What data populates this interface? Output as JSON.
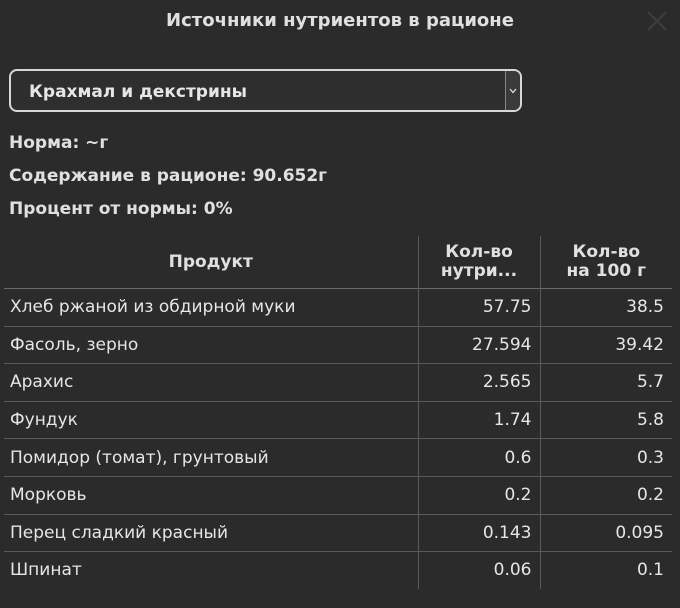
{
  "dialog": {
    "title": "Источники нутриентов в рационе"
  },
  "selector": {
    "selected": "Крахмал и декстрины"
  },
  "info": {
    "norm": "Норма: ~г",
    "content": "Содержание в рационе: 90.652г",
    "percent": "Процент от нормы: 0%"
  },
  "table": {
    "headers": {
      "product": "Продукт",
      "amount_line1": "Кол-во",
      "amount_line2": "нутри...",
      "per100_line1": "Кол-во",
      "per100_line2": "на 100 г"
    },
    "rows": [
      {
        "product": "Хлеб ржаной из обдирной муки",
        "amount": "57.75",
        "per100": "38.5"
      },
      {
        "product": "Фасоль, зерно",
        "amount": "27.594",
        "per100": "39.42"
      },
      {
        "product": "Арахис",
        "amount": "2.565",
        "per100": "5.7"
      },
      {
        "product": "Фундук",
        "amount": "1.74",
        "per100": "5.8"
      },
      {
        "product": "Помидор (томат), грунтовый",
        "amount": "0.6",
        "per100": "0.3"
      },
      {
        "product": "Морковь",
        "amount": "0.2",
        "per100": "0.2"
      },
      {
        "product": "Перец сладкий красный",
        "amount": "0.143",
        "per100": "0.095"
      },
      {
        "product": "Шпинат",
        "amount": "0.06",
        "per100": "0.1"
      }
    ]
  },
  "icons": {
    "close": "close-icon",
    "dropdown": "chevron-down-icon"
  }
}
